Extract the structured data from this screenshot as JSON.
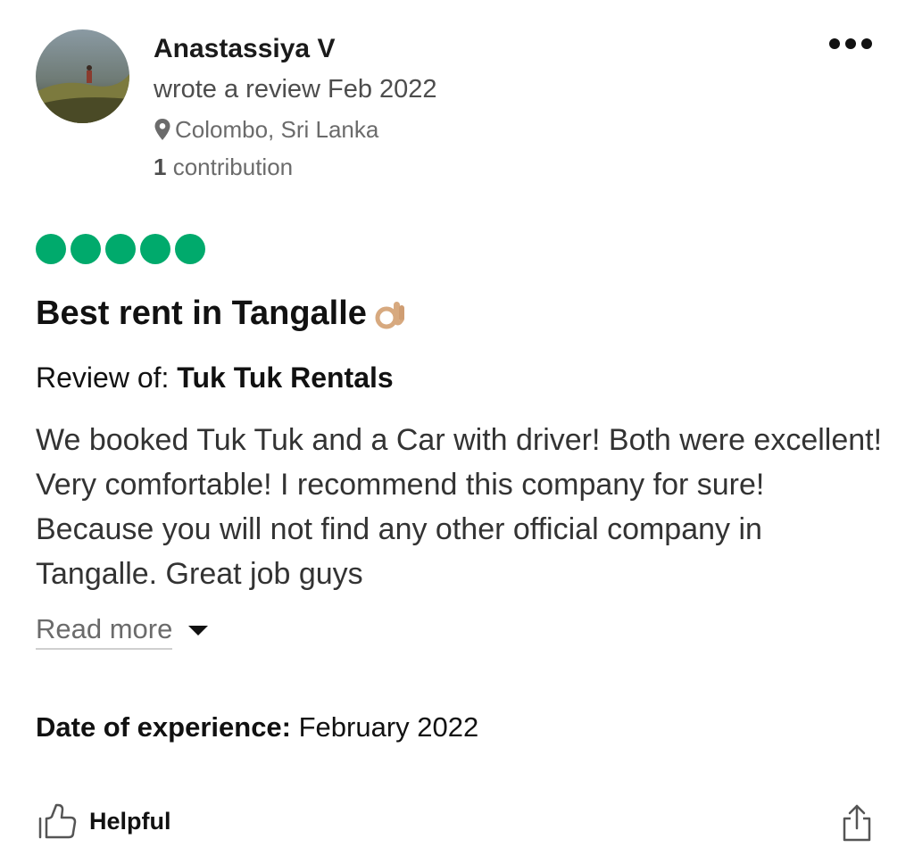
{
  "reviewer": {
    "name": "Anastassiya V",
    "wrote": "wrote a review Feb 2022",
    "location": "Colombo, Sri Lanka",
    "contributions_count": "1",
    "contributions_label": "contribution"
  },
  "menu_icon": "more-dots-icon",
  "rating": {
    "value": 5,
    "max": 5,
    "color": "#00aa6c"
  },
  "review": {
    "title": "Best rent in Tangalle",
    "title_emoji": "ok-hand-emoji",
    "review_of_label": "Review of:",
    "review_of_name": "Tuk Tuk Rentals",
    "text": "We booked Tuk Tuk and a Car with driver! Both were excellent! Very comfortable! I recommend this company for sure! Because you will not find any other official company in Tangalle. Great job guys",
    "read_more": "Read more",
    "date_label": "Date of experience:",
    "date_value": "February 2022"
  },
  "actions": {
    "helpful_label": "Helpful",
    "helpful_icon": "thumbs-up-icon",
    "share_icon": "share-icon"
  }
}
